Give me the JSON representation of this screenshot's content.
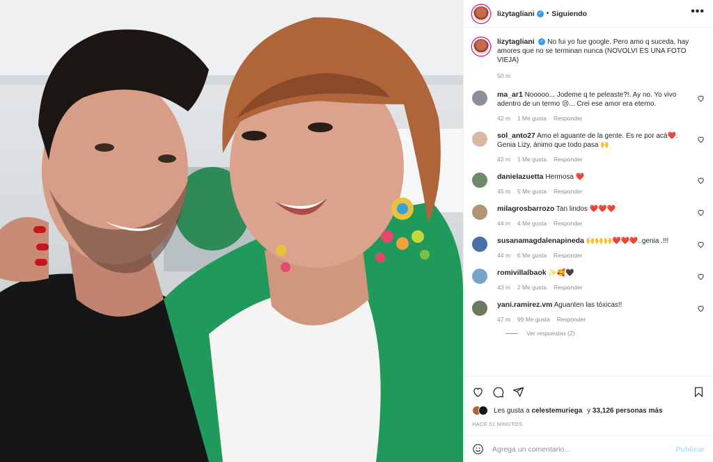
{
  "header": {
    "username": "lizytagliani",
    "separator": "•",
    "follow_label": "Siguiendo",
    "more_label": "•••"
  },
  "caption": {
    "username": "lizytagliani",
    "text": "No fui yo fue google. Pero amo q suceda, hay amores que no se terminan nunca (NOVOLVI ES UNA FOTO VIEJA)",
    "time": "50 m"
  },
  "comments": [
    {
      "user": "ma_ar1",
      "text": "Nooooo... Jodeme q te peleaste?!. Ay no. Yo vivo adentro de un termo 😢... Crei ese amor era eterno.",
      "time": "42 m",
      "likes": "1 Me gusta",
      "reply": "Responder",
      "avatar_color": "#8a8f98"
    },
    {
      "user": "sol_anto27",
      "text": "Amo el aguante de la gente. Es re por acá❤️. Genia Lizy, ánimo que todo pasa 🙌",
      "time": "42 m",
      "likes": "1 Me gusta",
      "reply": "Responder",
      "avatar_color": "#d9b8a3"
    },
    {
      "user": "danielazuetta",
      "text": "Hermosa ❤️",
      "time": "45 m",
      "likes": "5 Me gusta",
      "reply": "Responder",
      "avatar_color": "#6d8a6a"
    },
    {
      "user": "milagrosbarrozo",
      "text": "Tan lindos ❤️❤️❤️",
      "time": "44 m",
      "likes": "4 Me gusta",
      "reply": "Responder",
      "avatar_color": "#b29478"
    },
    {
      "user": "susanamagdalenapineda",
      "text": "🙌🙌🙌❤️❤️❤️..genia .!!!",
      "time": "44 m",
      "likes": "6 Me gusta",
      "reply": "Responder",
      "avatar_color": "#4a6ea8"
    },
    {
      "user": "romivillalbaok",
      "text": "✨🥰🖤",
      "time": "43 m",
      "likes": "2 Me gusta",
      "reply": "Responder",
      "avatar_color": "#7aa3c9"
    },
    {
      "user": "yani.ramirez.vm",
      "text": "Aguanten las tóxicas!!",
      "time": "47 m",
      "likes": "99 Me gusta",
      "reply": "Responder",
      "avatar_color": "#6b7a5e"
    }
  ],
  "view_replies": "Ver respuestas (2)",
  "likes": {
    "prefix": "Les gusta a",
    "user": "celestemuriega",
    "middle": "y",
    "count": "33,126 personas más"
  },
  "posted_ago": "HACE 51 MINUTOS",
  "add_comment": {
    "placeholder": "Agrega un comentario...",
    "publish_label": "Publicar"
  },
  "colors": {
    "accent": "#0095f6",
    "heart_red": "#ed1c34",
    "jacket_green": "#1f9a5a"
  },
  "icons": [
    "heart-icon",
    "comment-icon",
    "share-icon",
    "bookmark-icon",
    "emoji-icon",
    "verified-icon",
    "more-icon"
  ]
}
